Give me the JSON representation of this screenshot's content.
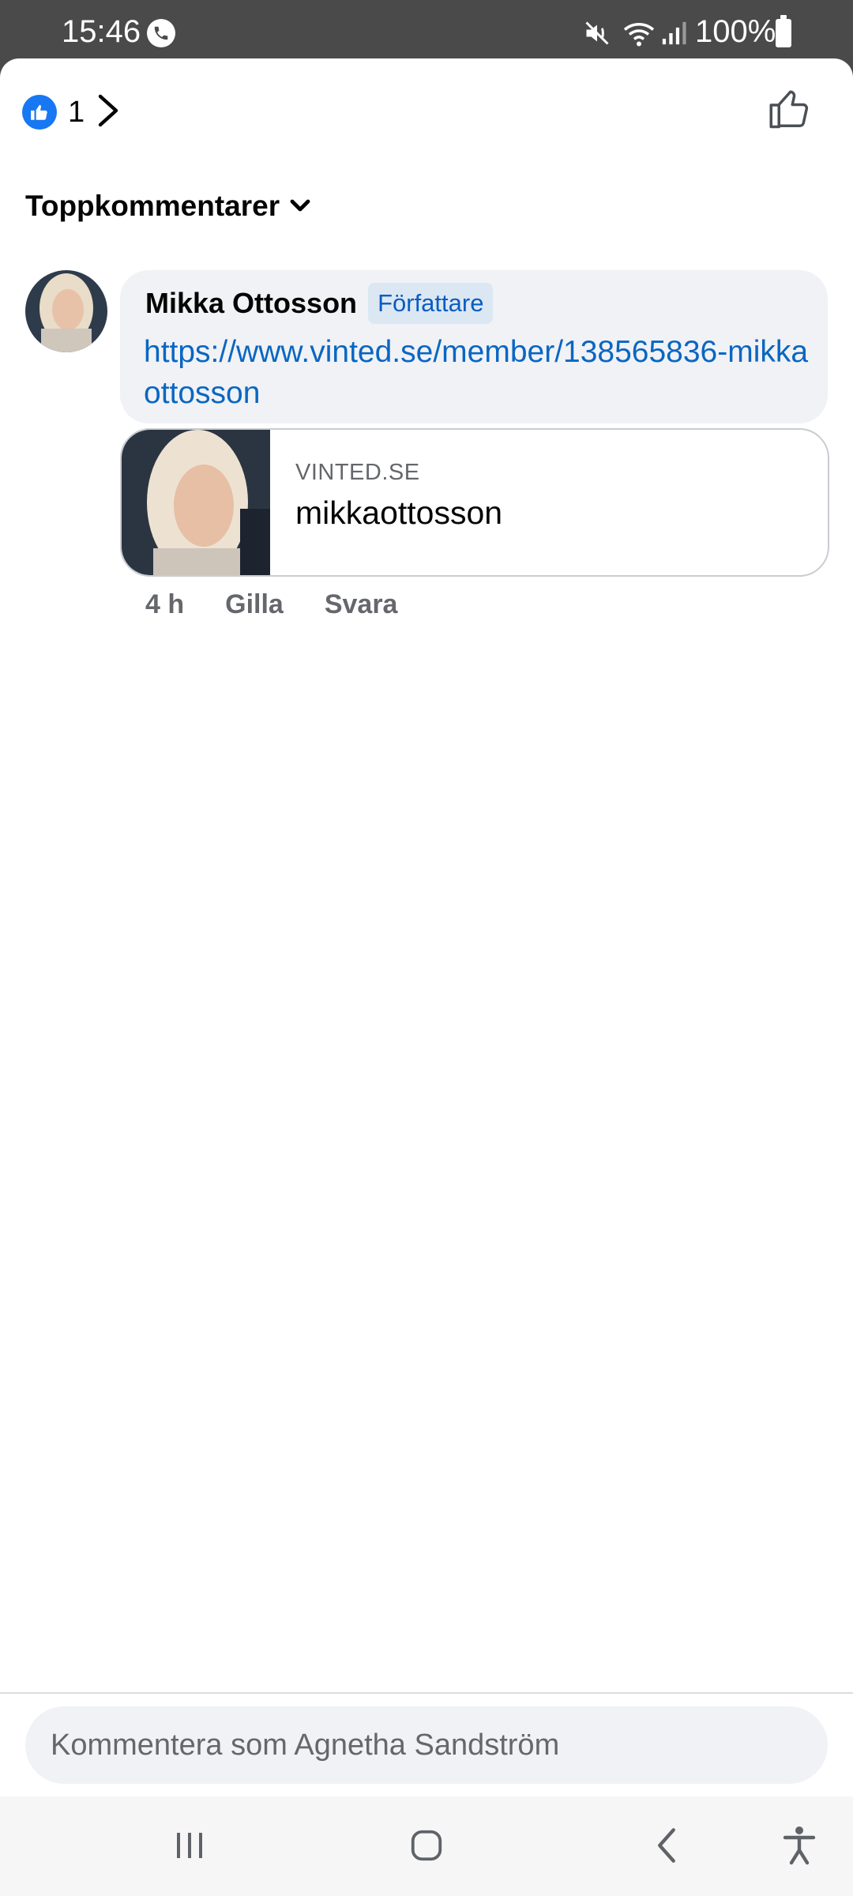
{
  "status_bar": {
    "time": "15:46",
    "battery": "100%",
    "icons": [
      "phone-call-icon",
      "mute-icon",
      "wifi-icon",
      "signal-icon",
      "battery-icon"
    ]
  },
  "reactions": {
    "count": "1",
    "icon": "like-reaction-icon"
  },
  "filter": {
    "label": "Toppkommentarer"
  },
  "comment": {
    "author": "Mikka Ottosson",
    "badge": "Författare",
    "text": "https://www.vinted.se/member/138565836-mikkaottosson",
    "time": "4 h",
    "like_action": "Gilla",
    "reply_action": "Svara"
  },
  "link_preview": {
    "domain": "VINTED.SE",
    "title": "mikkaottosson"
  },
  "composer": {
    "placeholder": "Kommentera som Agnetha Sandström"
  },
  "colors": {
    "accent_blue": "#1877f2",
    "link_blue": "#0a66c2",
    "bubble_bg": "#f0f2f5",
    "status_bar_bg": "#4a4a4a"
  }
}
